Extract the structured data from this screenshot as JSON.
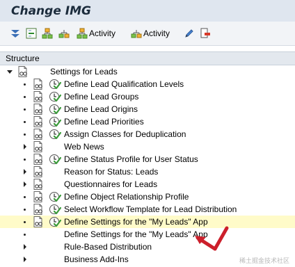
{
  "window": {
    "title": "Change IMG"
  },
  "toolbar": {
    "activity1_label": "Activity",
    "activity2_label": "Activity"
  },
  "structure": {
    "header": "Structure",
    "root": {
      "label": "Settings for Leads"
    },
    "items": [
      {
        "label": "Define Lead Qualification Levels"
      },
      {
        "label": "Define Lead Groups"
      },
      {
        "label": "Define Lead Origins"
      },
      {
        "label": "Define Lead Priorities"
      },
      {
        "label": "Assign Classes for Deduplication"
      },
      {
        "label": "Web News"
      },
      {
        "label": "Define Status Profile for User Status"
      },
      {
        "label": "Reason for Status: Leads"
      },
      {
        "label": "Questionnaires for Leads"
      },
      {
        "label": "Define Object Relationship Profile"
      },
      {
        "label": "Select Workflow Template for Lead Distribution"
      },
      {
        "label": "Define Settings for the \"My Leads\" App"
      },
      {
        "label": "Define Settings for the \"My Leads\" App"
      },
      {
        "label": "Rule-Based Distribution"
      },
      {
        "label": "Business Add-Ins"
      }
    ]
  },
  "watermark": "稀土掘金技术社区",
  "colors": {
    "title_bar": "#dfe6ef",
    "selected_row": "#fffbc9",
    "annotation_arrow": "#cc1f2b",
    "check_green": "#3a9a3a"
  }
}
